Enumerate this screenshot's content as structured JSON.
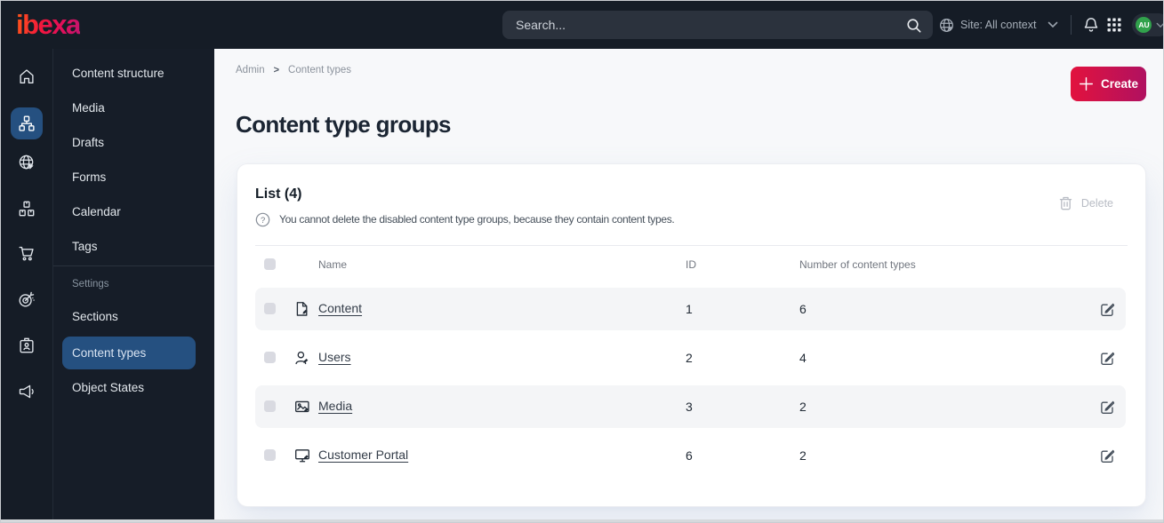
{
  "topbar": {
    "logo_text": "ibexa",
    "search_placeholder": "Search...",
    "site_label": "Site: All context",
    "avatar_initials": "AU"
  },
  "rail_icons": [
    "home",
    "content-structure",
    "search-globe",
    "product-catalog",
    "commerce-cart",
    "personalization-target",
    "admin-badge",
    "activity-megaphone"
  ],
  "rail_active": "content-structure",
  "sidebar": {
    "items": [
      {
        "label": "Content structure"
      },
      {
        "label": "Media"
      },
      {
        "label": "Drafts"
      },
      {
        "label": "Forms"
      },
      {
        "label": "Calendar"
      },
      {
        "label": "Tags"
      }
    ],
    "section_label": "Settings",
    "settings_items": [
      {
        "label": "Sections"
      },
      {
        "label": "Content types",
        "active": true
      },
      {
        "label": "Object States"
      }
    ]
  },
  "breadcrumb": {
    "items": [
      "Admin",
      "Content types"
    ],
    "separator": ">"
  },
  "page": {
    "title": "Content type groups",
    "create_label": "Create"
  },
  "panel": {
    "list_title": "List (4)",
    "info_text": "You cannot delete the disabled content type groups, because they contain content types.",
    "info_icon": "?",
    "delete_label": "Delete"
  },
  "table": {
    "headers": {
      "name": "Name",
      "id": "ID",
      "count": "Number of content types"
    },
    "rows": [
      {
        "icon": "file",
        "name": "Content",
        "id": "1",
        "count": "6"
      },
      {
        "icon": "user",
        "name": "Users",
        "id": "2",
        "count": "4"
      },
      {
        "icon": "image",
        "name": "Media",
        "id": "3",
        "count": "2"
      },
      {
        "icon": "monitor",
        "name": "Customer Portal",
        "id": "6",
        "count": "2"
      }
    ]
  },
  "colors": {
    "topbar_bg": "#151c26",
    "accent_gradient_start": "#e2123e",
    "accent_gradient_end": "#b01160",
    "selected_blue": "#255080",
    "avatar_green": "#31a24c",
    "row_alt_bg": "#f4f5f7"
  }
}
